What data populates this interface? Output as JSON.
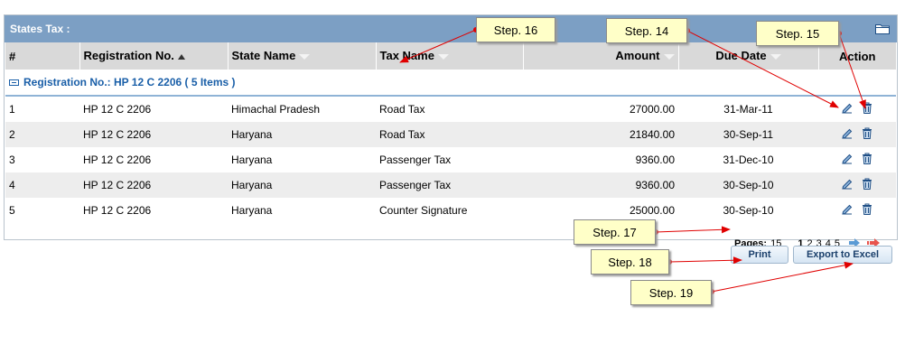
{
  "panel": {
    "title": "States Tax :"
  },
  "columns": [
    {
      "label": "#"
    },
    {
      "label": "Registration No."
    },
    {
      "label": "State Name"
    },
    {
      "label": "Tax Name"
    },
    {
      "label": "Amount"
    },
    {
      "label": "Due Date"
    },
    {
      "label": "Action"
    }
  ],
  "group": {
    "label": "Registration No.: HP 12 C 2206 ( 5 Items )"
  },
  "rows": [
    {
      "n": "1",
      "reg": "HP 12 C 2206",
      "state": "Himachal Pradesh",
      "tax": "Road Tax",
      "amount": "27000.00",
      "due": "31-Mar-11"
    },
    {
      "n": "2",
      "reg": "HP 12 C 2206",
      "state": "Haryana",
      "tax": "Road Tax",
      "amount": "21840.00",
      "due": "30-Sep-11"
    },
    {
      "n": "3",
      "reg": "HP 12 C 2206",
      "state": "Haryana",
      "tax": "Passenger Tax",
      "amount": "9360.00",
      "due": "31-Dec-10"
    },
    {
      "n": "4",
      "reg": "HP 12 C 2206",
      "state": "Haryana",
      "tax": "Passenger Tax",
      "amount": "9360.00",
      "due": "30-Sep-10"
    },
    {
      "n": "5",
      "reg": "HP 12 C 2206",
      "state": "Haryana",
      "tax": "Counter Signature",
      "amount": "25000.00",
      "due": "30-Sep-10"
    }
  ],
  "pager": {
    "label": "Pages:",
    "count": "15",
    "pages": [
      "1",
      "2",
      "3",
      "4",
      "5"
    ]
  },
  "buttons": {
    "print": "Print",
    "export": "Export to Excel"
  },
  "callouts": {
    "s14": "Step. 14",
    "s15": "Step. 15",
    "s16": "Step. 16",
    "s17": "Step. 17",
    "s18": "Step. 18",
    "s19": "Step. 19"
  },
  "colors": {
    "header": "#7c9fc4",
    "accent": "#1a5fa8",
    "callout": "#ffffc8",
    "arrow": "#e00000"
  },
  "icons": [
    "folder-icon",
    "sort-asc-icon",
    "sort-icon",
    "edit-icon",
    "delete-icon",
    "next-page-icon",
    "last-page-icon"
  ]
}
